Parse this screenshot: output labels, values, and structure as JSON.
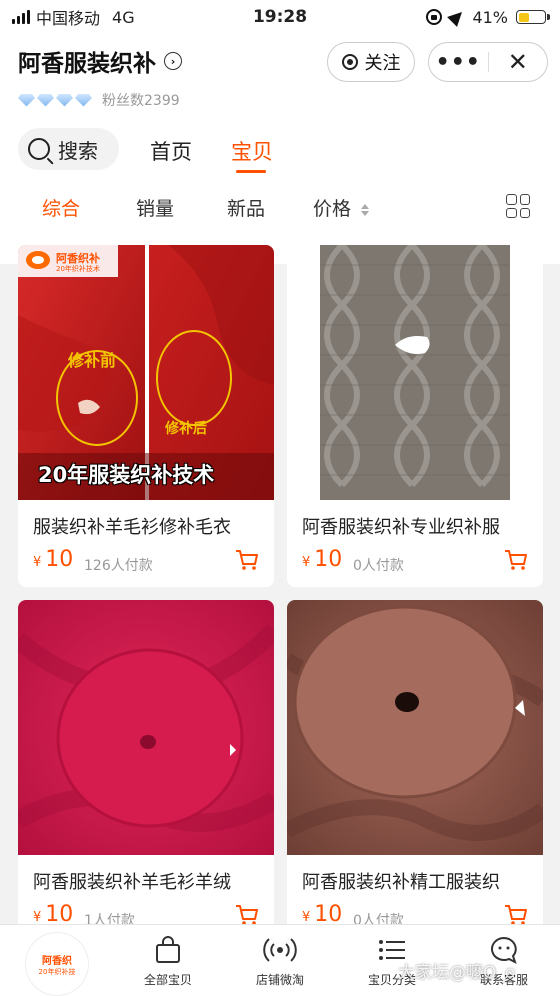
{
  "status_bar": {
    "carrier": "中国移动",
    "network": "4G",
    "time": "19:28",
    "battery": "41%"
  },
  "header": {
    "shop_name": "阿香服装织补",
    "follow_label": "关注",
    "more_label": "•••",
    "close_label": "✕",
    "fans_text": "粉丝数2399"
  },
  "nav": {
    "search_label": "搜索",
    "tabs": [
      {
        "label": "首页",
        "active": false
      },
      {
        "label": "宝贝",
        "active": true
      }
    ]
  },
  "sort": {
    "items": [
      {
        "label": "综合",
        "active": true
      },
      {
        "label": "销量",
        "active": false
      },
      {
        "label": "新品",
        "active": false
      },
      {
        "label": "价格",
        "active": false
      }
    ]
  },
  "products": [
    {
      "title": "服装织补羊毛衫修补毛衣",
      "currency": "¥",
      "price": "10",
      "sold": "126人付款",
      "image_text": {
        "logo": "阿香织补",
        "logo_sub": "20年织补技术",
        "before": "修补前",
        "after": "修补后",
        "banner": "20年服装织补技术"
      }
    },
    {
      "title": "阿香服装织补专业织补服",
      "currency": "¥",
      "price": "10",
      "sold": "0人付款"
    },
    {
      "title": "阿香服装织补羊毛衫羊绒",
      "currency": "¥",
      "price": "10",
      "sold": "1人付款"
    },
    {
      "title": "阿香服装织补精工服装织",
      "currency": "¥",
      "price": "10",
      "sold": "0人付款"
    }
  ],
  "tabbar": {
    "logo_text": "阿香织",
    "logo_sub": "20年织补技",
    "items": [
      {
        "label": "全部宝贝"
      },
      {
        "label": "店铺微淘"
      },
      {
        "label": "宝贝分类"
      },
      {
        "label": "联系客服"
      }
    ]
  },
  "watermark": "大家坛@嚒O_o",
  "colors": {
    "accent": "#ff5000",
    "price": "#ff5000"
  }
}
